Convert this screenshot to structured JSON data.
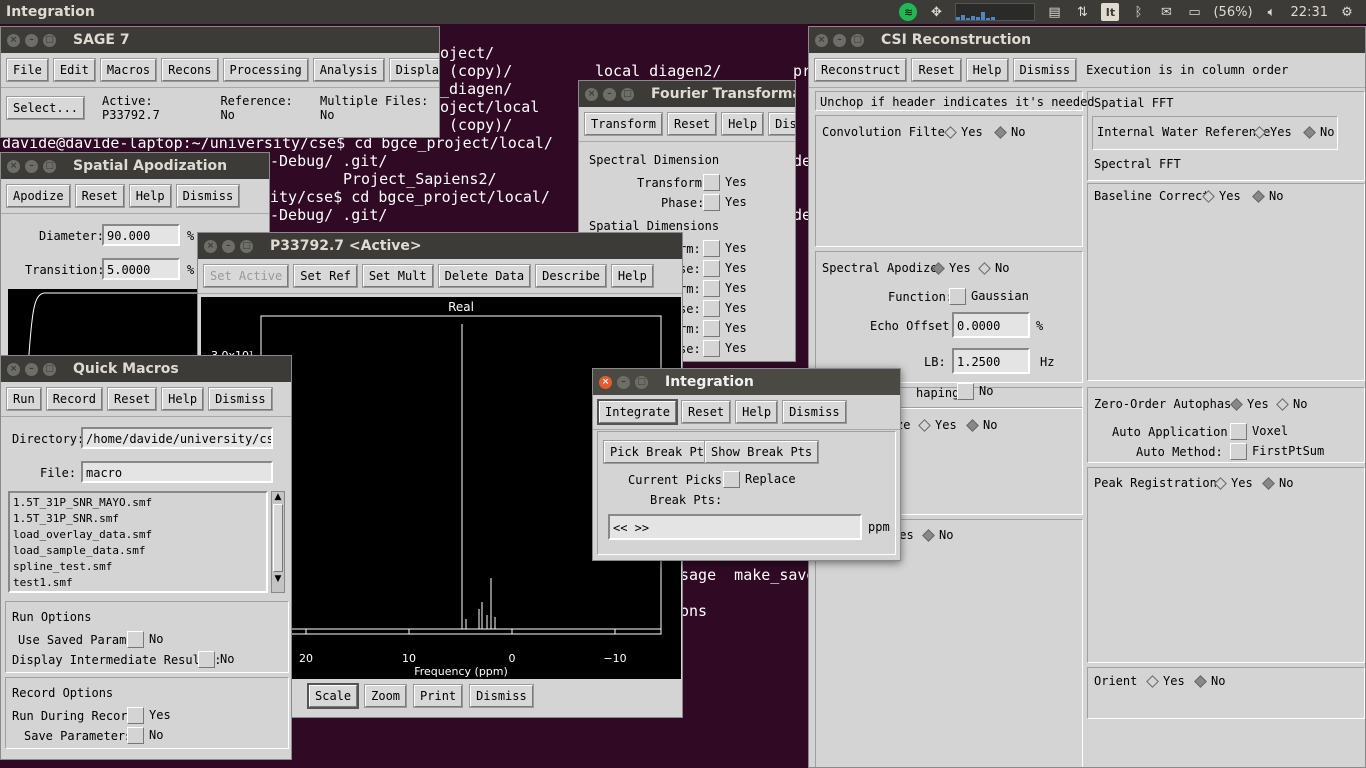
{
  "topbar": {
    "title": "Integration",
    "battery": "(56%)",
    "clock": "22:31",
    "keyboard_indicator": "It"
  },
  "terminal": {
    "lines": [
      "oject/",
      " (copy)/",
      "_diagen/",
      "oject/local",
      " (copy)/",
      "davide@davide-laptop:~/university/cse$ cd bgce_project/local/",
      "-Debug/ .git/",
      "Project_Sapiens2/",
      "ity/cse$ cd bgce_project/local/",
      "-Debug/ .git/",
      "local diagen2/",
      "pr",
      "de",
      "de",
      "sage  make_save",
      "ons"
    ]
  },
  "sage": {
    "title": "SAGE 7",
    "menu": [
      "File",
      "Edit",
      "Macros",
      "Recons",
      "Processing",
      "Analysis",
      "Display"
    ],
    "select_label": "Select...",
    "active": "Active: P33792.7",
    "reference": "Reference: No",
    "multiple_files": "Multiple Files: No"
  },
  "apod": {
    "title": "Spatial Apodization",
    "buttons": [
      "Apodize",
      "Reset",
      "Help",
      "Dismiss"
    ],
    "diameter_label": "Diameter:",
    "diameter_value": "90.000",
    "transition_label": "Transition:",
    "transition_value": "5.0000",
    "unit": "%"
  },
  "fourier": {
    "title": "Fourier Transforma",
    "buttons": [
      "Transform",
      "Reset",
      "Help",
      "Dismiss"
    ],
    "spectral_dim": "Spectral Dimension",
    "transform_label": "Transform:",
    "phase_label": "Phase:",
    "yes": "Yes",
    "spatial_dims": "Spatial Dimensions",
    "rows": [
      "rm:",
      "se:",
      "rm:",
      "se:",
      "rm:",
      "se:"
    ]
  },
  "p33792": {
    "title": "P33792.7 <Active>",
    "buttons": [
      "Set Active",
      "Set Ref",
      "Set Mult",
      "Delete Data",
      "Describe",
      "Help"
    ],
    "bottom_buttons": [
      "Scale",
      "Zoom",
      "Print",
      "Dismiss"
    ],
    "plot_title": "Real",
    "yaxis_partial": "3.0x10¹",
    "xlabel": "Frequency (ppm)",
    "xticks": [
      "20",
      "10",
      "0",
      "−10"
    ]
  },
  "macros": {
    "title": "Quick Macros",
    "buttons": [
      "Run",
      "Record",
      "Reset",
      "Help",
      "Dismiss"
    ],
    "directory_label": "Directory:",
    "directory_value": "/home/davide/university/cse/it",
    "file_label": "File:",
    "file_value": "macro",
    "files": [
      "1.5T_31P_SNR_MAYO.smf",
      "1.5T_31P_SNR.smf",
      "load_overlay_data.smf",
      "load_sample_data.smf",
      "spline_test.smf",
      "test1.smf"
    ],
    "run_options": "Run Options",
    "use_saved": "Use Saved Params:",
    "display_inter": "Display Intermediate Results:",
    "no": "No",
    "yes": "Yes",
    "record_options": "Record Options",
    "run_during": "Run During Record:",
    "save_params": "Save Parameters:"
  },
  "integration": {
    "title": "Integration",
    "buttons": [
      "Integrate",
      "Reset",
      "Help",
      "Dismiss"
    ],
    "pick_label": "Pick Break Pts",
    "show_label": "Show Break Pts",
    "current_picks": "Current Picks:",
    "replace": "Replace",
    "break_pts": "Break Pts:",
    "break_value": "<< >>",
    "unit": "ppm"
  },
  "csi": {
    "title": "CSI Reconstruction",
    "buttons": [
      "Reconstruct",
      "Reset",
      "Help",
      "Dismiss"
    ],
    "exec_text": "Execution is in column order",
    "unchop": "Unchop if header indicates it's needed",
    "convolution": "Convolution Filter",
    "spatial_fft": "Spatial FFT",
    "internal_water": "Internal Water Reference",
    "spectral_fft": "Spectral FFT",
    "baseline": "Baseline Correct",
    "spectral_apod": "Spectral Apodize",
    "function_label": "Function:",
    "function_value": "Gaussian",
    "echo_label": "Echo Offset:",
    "echo_value": "0.0000",
    "echo_unit": "%",
    "lb_label": "LB:",
    "lb_value": "1.2500",
    "lb_unit": "Hz",
    "shaping": "haping:",
    "ze": "ze",
    "zero_order": "Zero-Order Autophase",
    "auto_app": "Auto Application:",
    "voxel": "Voxel",
    "auto_method": "Auto Method:",
    "firstpt": "FirstPtSum",
    "peak_reg": "Peak Registration",
    "orient": "Orient",
    "yes": "Yes",
    "no": "No"
  }
}
